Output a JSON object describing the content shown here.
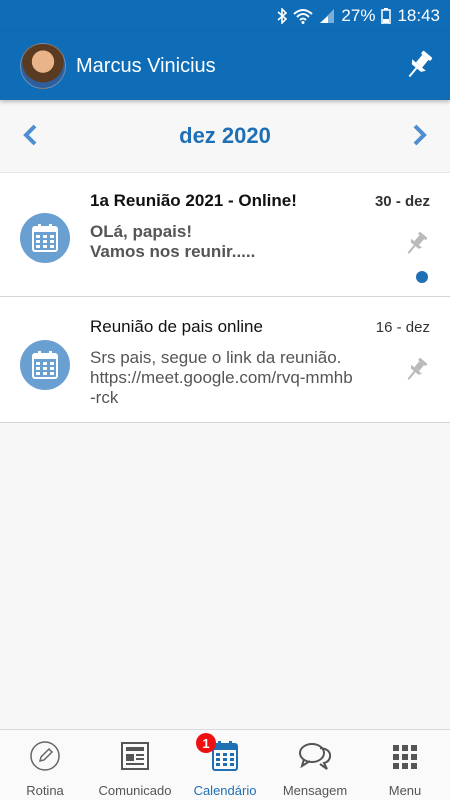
{
  "status": {
    "battery": "27%",
    "time": "18:43"
  },
  "header": {
    "user_name": "Marcus Vinicius"
  },
  "calendar": {
    "month_label": "dez 2020"
  },
  "items": [
    {
      "title": "1a Reunião 2021 - Online!",
      "date": "30 - dez",
      "body": "OLá, papais!\nVamos nos reunir.....",
      "unread": true
    },
    {
      "title": "Reunião de pais online",
      "date": "16 - dez",
      "body": "Srs pais, segue o link da reunião.\nhttps://meet.google.com/rvq-mmhb\n-rck",
      "unread": false
    }
  ],
  "nav": [
    {
      "label": "Rotina",
      "icon": "pencil-icon"
    },
    {
      "label": "Comunicado",
      "icon": "newspaper-icon"
    },
    {
      "label": "Calendário",
      "icon": "calendar-icon",
      "active": true,
      "badge": "1"
    },
    {
      "label": "Mensagem",
      "icon": "chat-icon"
    },
    {
      "label": "Menu",
      "icon": "grid-icon"
    }
  ],
  "colors": {
    "primary": "#0f6db8",
    "accent": "#1f6fb5",
    "badge": "#e11111",
    "icon_circle": "#6a9fd2"
  }
}
